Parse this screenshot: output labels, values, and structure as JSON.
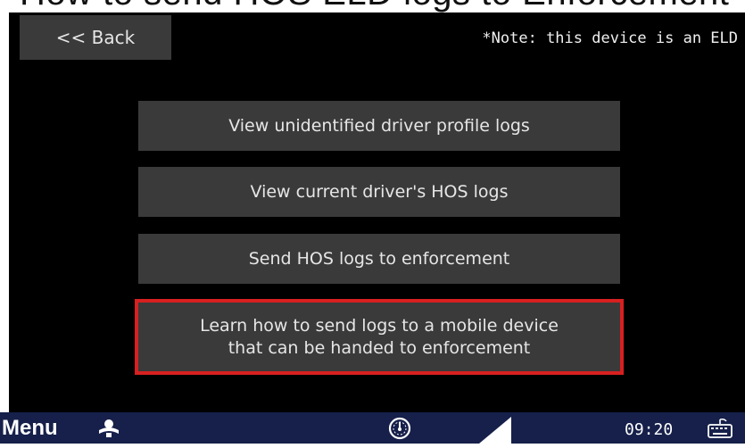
{
  "caption": "How to send HOS ELD logs to Enforcement",
  "header": {
    "back_label": "<< Back",
    "note": "*Note: this device is an ELD"
  },
  "menu": {
    "items": [
      {
        "label": "View unidentified driver profile logs",
        "highlighted": false
      },
      {
        "label": "View current driver's HOS logs",
        "highlighted": false
      },
      {
        "label": "Send HOS logs to enforcement",
        "highlighted": false
      },
      {
        "label": "Learn how to send logs to a mobile device",
        "label_line2": "that can be handed to enforcement",
        "highlighted": true
      }
    ]
  },
  "taskbar": {
    "menu_label": "Menu",
    "clock": "09:20",
    "icons": [
      "driver-status-icon",
      "speedometer-icon",
      "signal-strength-icon",
      "keyboard-icon"
    ]
  },
  "colors": {
    "screen_bg": "#000000",
    "button_bg": "#3a3a3a",
    "button_text": "#e6e6e6",
    "highlight_border": "#d82020",
    "taskbar_bg": "#16204a"
  }
}
